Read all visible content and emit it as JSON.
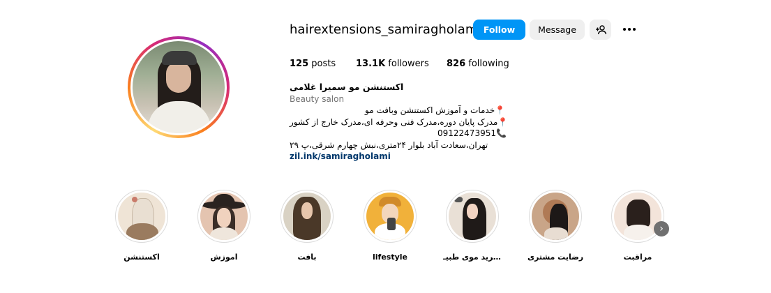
{
  "profile": {
    "username": "hairextensions_samiragholami",
    "follow_label": "Follow",
    "message_label": "Message",
    "add_user_icon": "add-user-icon",
    "more_icon": "more-options-icon"
  },
  "stats": {
    "posts_count": "125",
    "posts_label": "posts",
    "followers_count": "13.1K",
    "followers_label": "followers",
    "following_count": "826",
    "following_label": "following"
  },
  "bio": {
    "name": "اکستنشن مو سمیرا غلامی",
    "category": "Beauty salon",
    "line1": "خدمات و آموزش اکستنشن وبافت مو",
    "line2": "مدرک پایان دوره،مدرک فنی وحرفه ای،مدرک خارج از کشور",
    "phone": "09122473951",
    "address": "تهران،سعادت آباد بلوار ۲۴متری،نبش چهارم شرقی،پ ۲۹",
    "link": "zil.ink/samiragholami",
    "pin_icon": "pin-icon",
    "phone_icon": "phone-icon"
  },
  "highlights": [
    {
      "label": "اکستنشن"
    },
    {
      "label": "اموزش"
    },
    {
      "label": "بافت"
    },
    {
      "label": "lifestyle"
    },
    {
      "label": "خرید موی طبیـ..."
    },
    {
      "label": "رضایت مشتری"
    },
    {
      "label": "مراقبت"
    }
  ],
  "colors": {
    "follow_button": "#0095f6",
    "secondary_button": "#efefef",
    "link": "#00376b",
    "muted_text": "#737373"
  }
}
